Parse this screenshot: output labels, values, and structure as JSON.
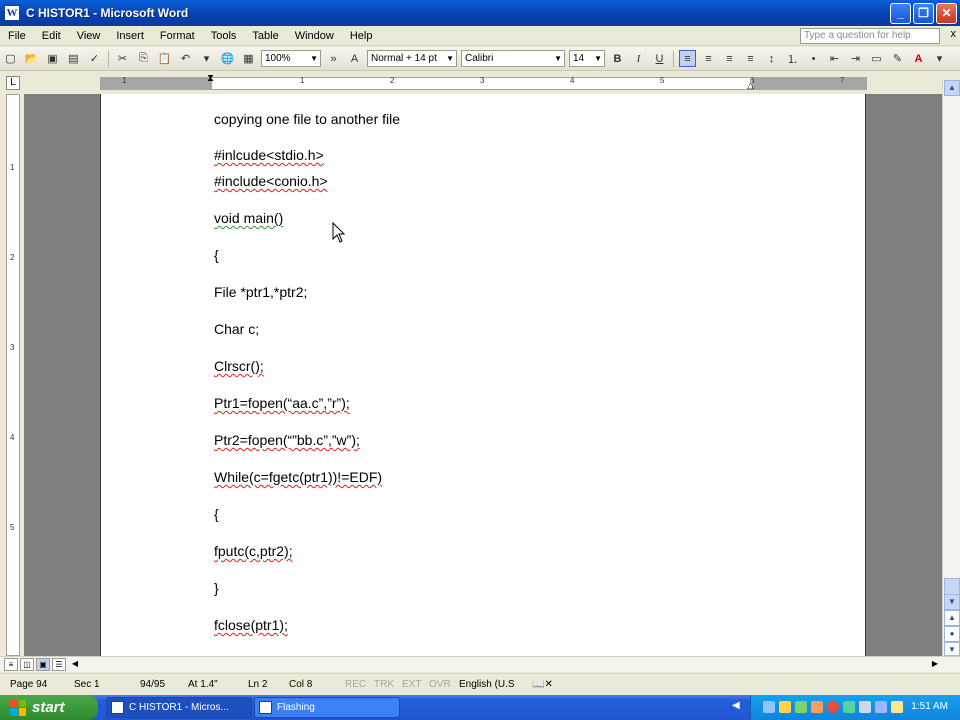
{
  "window": {
    "title": "C  HISTOR1 - Microsoft Word",
    "app_icon": "word-icon",
    "controls": [
      "minimize-icon",
      "restore-icon",
      "close-icon"
    ]
  },
  "menubar": {
    "items": [
      "File",
      "Edit",
      "View",
      "Insert",
      "Format",
      "Tools",
      "Table",
      "Window",
      "Help"
    ],
    "help_placeholder": "Type a question for help",
    "close_glyph": "x"
  },
  "toolbar": {
    "zoom": "100%",
    "style": "Normal + 14 pt",
    "font": "Calibri",
    "size": "14",
    "bold": "B",
    "italic": "I",
    "underline": "U",
    "font_color_glyph": "A"
  },
  "ruler": {
    "corner_glyph": "L",
    "numbers": [
      "1",
      "1",
      "2",
      "3",
      "4",
      "5",
      "6",
      "7"
    ]
  },
  "vruler": {
    "numbers": [
      "1",
      "2",
      "3",
      "4",
      "5"
    ]
  },
  "document": {
    "lines": [
      "copying one file to another file",
      "#inlcude<stdio.h>",
      "#include<conio.h>",
      "void main()",
      "{",
      "File *ptr1,*ptr2;",
      "Char c;",
      "Clrscr();",
      "Ptr1=fopen(“aa.c”,”r”);",
      "Ptr2=fopen(“”bb.c”,”w”);",
      "While(c=fgetc(ptr1))!=EDF)",
      "{",
      "fputc(c,ptr2);",
      "}",
      "fclose(ptr1);"
    ]
  },
  "statusbar": {
    "page": "Page 94",
    "sec": "Sec  1",
    "pages": "94/95",
    "at": "At 1.4\"",
    "ln": "Ln 2",
    "col": "Col 8",
    "rec": "REC",
    "trk": "TRK",
    "ext": "EXT",
    "ovr": "OVR",
    "language": "English (U.S"
  },
  "taskbar": {
    "start_label": "start",
    "tasks": [
      "C  HISTOR1 - Micros...",
      "Flashing"
    ],
    "clock": "1:51 AM"
  },
  "colors": {
    "title_bar": "#0842b0",
    "start_button": "#2f8a2f",
    "taskbar": "#245edb",
    "spelling_error": "#e02020",
    "grammar_error": "#2a9d2a"
  }
}
